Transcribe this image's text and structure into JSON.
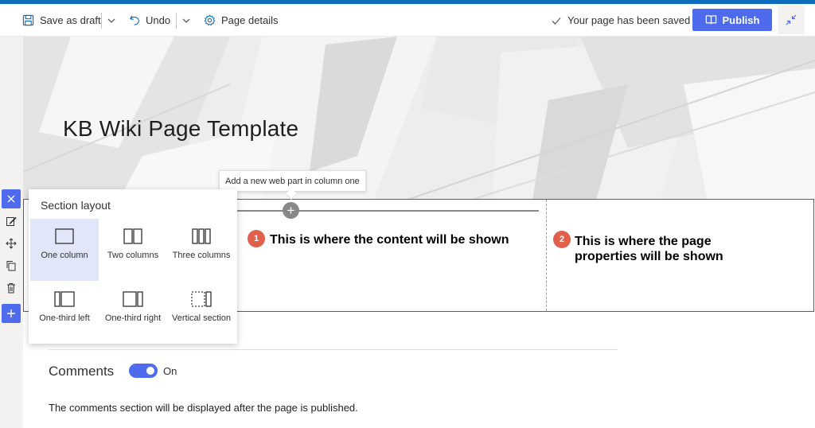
{
  "toolbar": {
    "save_draft_label": "Save as draft",
    "undo_label": "Undo",
    "page_details_label": "Page details",
    "saved_status": "Your page has been saved",
    "publish_label": "Publish"
  },
  "hero": {
    "title": "KB Wiki Page Template"
  },
  "tooltip": {
    "text": "Add a new web part in column one"
  },
  "section": {
    "add_symbol": "+",
    "notes": [
      {
        "badge": "1",
        "text": "This is where the content will be shown"
      },
      {
        "badge": "2",
        "text_line1": "This is where the page",
        "text_line2": "properties will be shown"
      }
    ]
  },
  "section_layout": {
    "title": "Section layout",
    "selected": "One column",
    "options": [
      {
        "label": "One column"
      },
      {
        "label": "Two columns"
      },
      {
        "label": "Three columns"
      },
      {
        "label": "One-third left"
      },
      {
        "label": "One-third right"
      },
      {
        "label": "Vertical section"
      }
    ]
  },
  "comments": {
    "title": "Comments",
    "toggle_state": "On",
    "info": "The comments section will be displayed after the page is published."
  },
  "colors": {
    "accent": "#0f6cbd",
    "publish": "#4f6bed",
    "badge": "#e0604a"
  }
}
